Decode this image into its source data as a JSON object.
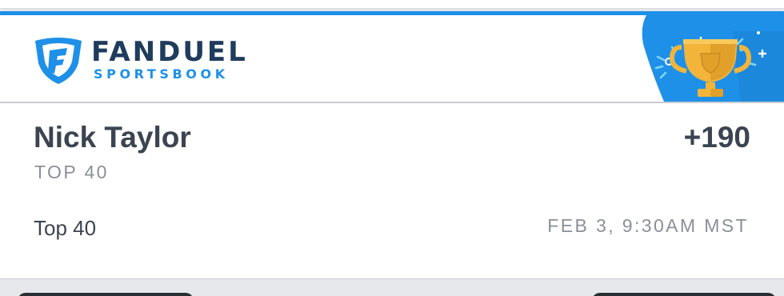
{
  "brand": {
    "name": "FANDUEL",
    "sub": "SPORTSBOOK",
    "colors": {
      "navy": "#1f3c5c",
      "blue": "#1e90e8",
      "gold": "#f2b53a"
    }
  },
  "ticket": {
    "accent_color": "#1e90e8",
    "badge_icon": "trophy-icon",
    "selection": "Nick Taylor",
    "odds": "+190",
    "market_upper": "TOP 40",
    "market": "Top 40",
    "event_time": "FEB 3, 9:30AM MST"
  }
}
